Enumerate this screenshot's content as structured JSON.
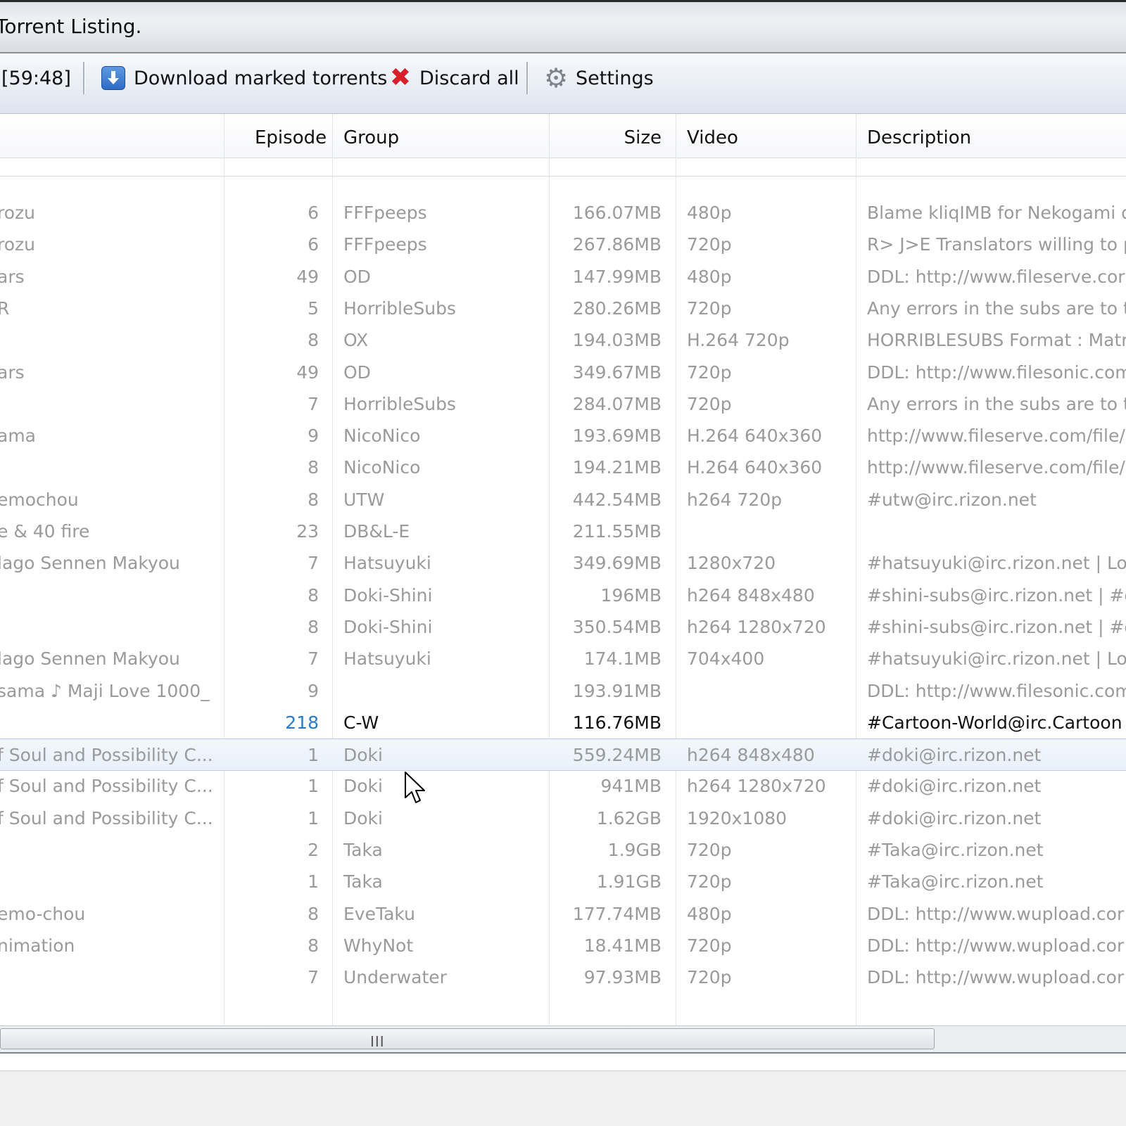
{
  "window": {
    "title": "Torrent Listing."
  },
  "toolbar": {
    "timer": "[59:48]",
    "download_label": "Download marked torrents",
    "discard_label": "Discard all",
    "settings_label": "Settings"
  },
  "columns": [
    "Episode",
    "Group",
    "Size",
    "Video",
    "Description"
  ],
  "rows": [
    {
      "name": "rozu",
      "episode": "6",
      "group": "FFFpeeps",
      "size": "166.07MB",
      "video": "480p",
      "description": "Blame kliqIMB for Nekogami de"
    },
    {
      "name": "rozu",
      "episode": "6",
      "group": "FFFpeeps",
      "size": "267.86MB",
      "video": "720p",
      "description": "R> J>E Translators willing to p"
    },
    {
      "name": "ars",
      "episode": "49",
      "group": "OD",
      "size": "147.99MB",
      "video": "480p",
      "description": "DDL: http://www.fileserve.cor"
    },
    {
      "name": "R",
      "episode": "5",
      "group": "HorribleSubs",
      "size": "280.26MB",
      "video": "720p",
      "description": "Any errors in the subs are to t"
    },
    {
      "name": "",
      "episode": "8",
      "group": "OX",
      "size": "194.03MB",
      "video": "H.264 720p",
      "description": "HORRIBLESUBS Format : Matr"
    },
    {
      "name": "ars",
      "episode": "49",
      "group": "OD",
      "size": "349.67MB",
      "video": "720p",
      "description": "DDL: http://www.filesonic.com"
    },
    {
      "name": "",
      "episode": "7",
      "group": "HorribleSubs",
      "size": "284.07MB",
      "video": "720p",
      "description": "Any errors in the subs are to t"
    },
    {
      "name": "ama",
      "episode": "9",
      "group": "NicoNico",
      "size": "193.69MB",
      "video": "H.264 640x360",
      "description": "http://www.fileserve.com/file/"
    },
    {
      "name": "",
      "episode": "8",
      "group": "NicoNico",
      "size": "194.21MB",
      "video": "H.264 640x360",
      "description": "http://www.fileserve.com/file/"
    },
    {
      "name": "emochou",
      "episode": "8",
      "group": "UTW",
      "size": "442.54MB",
      "video": "h264 720p",
      "description": "#utw@irc.rizon.net"
    },
    {
      "name": "e & 40 fire",
      "episode": "23",
      "group": "DB&L-E",
      "size": "211.55MB",
      "video": "",
      "description": ""
    },
    {
      "name": "lago Sennen Makyou",
      "episode": "7",
      "group": "Hatsuyuki",
      "size": "349.69MB",
      "video": "1280x720",
      "description": "#hatsuyuki@irc.rizon.net | Lo"
    },
    {
      "name": "",
      "episode": "8",
      "group": "Doki-Shini",
      "size": "196MB",
      "video": "h264 848x480",
      "description": "#shini-subs@irc.rizon.net | #c"
    },
    {
      "name": "",
      "episode": "8",
      "group": "Doki-Shini",
      "size": "350.54MB",
      "video": "h264 1280x720",
      "description": "#shini-subs@irc.rizon.net | #c"
    },
    {
      "name": "lago Sennen Makyou",
      "episode": "7",
      "group": "Hatsuyuki",
      "size": "174.1MB",
      "video": "704x400",
      "description": "#hatsuyuki@irc.rizon.net | Lo"
    },
    {
      "name": "sama ♪ Maji Love 1000_",
      "episode": "9",
      "group": "",
      "size": "193.91MB",
      "video": "",
      "description": "DDL: http://www.filesonic.com"
    },
    {
      "name": "",
      "episode": "218",
      "group": "C-W",
      "size": "116.76MB",
      "video": "",
      "description": "#Cartoon-World@irc.Cartoon",
      "bold": true
    },
    {
      "name": "f Soul and Possibility C...",
      "episode": "1",
      "group": "Doki",
      "size": "559.24MB",
      "video": "h264 848x480",
      "description": "#doki@irc.rizon.net",
      "selected": true
    },
    {
      "name": "f Soul and Possibility C...",
      "episode": "1",
      "group": "Doki",
      "size": "941MB",
      "video": "h264 1280x720",
      "description": "#doki@irc.rizon.net"
    },
    {
      "name": "f Soul and Possibility C...",
      "episode": "1",
      "group": "Doki",
      "size": "1.62GB",
      "video": "1920x1080",
      "description": "#doki@irc.rizon.net"
    },
    {
      "name": "",
      "episode": "2",
      "group": "Taka",
      "size": "1.9GB",
      "video": "720p",
      "description": "#Taka@irc.rizon.net"
    },
    {
      "name": "",
      "episode": "1",
      "group": "Taka",
      "size": "1.91GB",
      "video": "720p",
      "description": "#Taka@irc.rizon.net"
    },
    {
      "name": "emo-chou",
      "episode": "8",
      "group": "EveTaku",
      "size": "177.74MB",
      "video": "480p",
      "description": "DDL: http://www.wupload.cor"
    },
    {
      "name": "nimation",
      "episode": "8",
      "group": "WhyNot",
      "size": "18.41MB",
      "video": "720p",
      "description": "DDL: http://www.wupload.cor"
    },
    {
      "name": "",
      "episode": "7",
      "group": "Underwater",
      "size": "97.93MB",
      "video": "720p",
      "description": "DDL: http://www.wupload.cor"
    }
  ],
  "icons": {
    "download": "download-arrow-icon",
    "discard": "red-x-icon",
    "settings": "gear-icon",
    "cursor": "mouse-pointer-icon"
  },
  "scrollbar": {
    "grip": "III"
  }
}
